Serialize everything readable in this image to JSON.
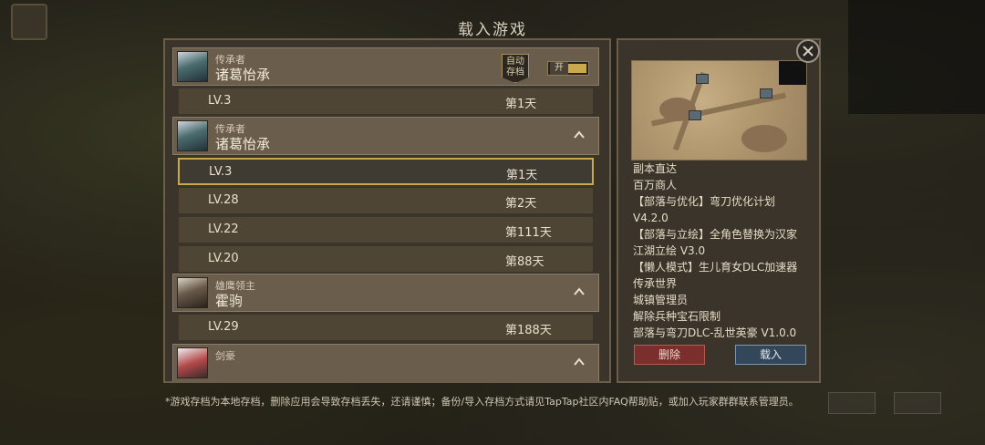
{
  "title": "载入游戏",
  "saves": [
    {
      "role": "传承者",
      "name": "诸葛怡承",
      "autosave_label": "自动存档",
      "toggle_label": "开",
      "entries": [
        {
          "level": "LV.3",
          "day": "第1天"
        }
      ]
    },
    {
      "role": "传承者",
      "name": "诸葛怡承",
      "entries": [
        {
          "level": "LV.3",
          "day": "第1天",
          "selected": true
        },
        {
          "level": "LV.28",
          "day": "第2天"
        },
        {
          "level": "LV.22",
          "day": "第111天"
        },
        {
          "level": "LV.20",
          "day": "第88天"
        }
      ]
    },
    {
      "role": "雄鹰领主",
      "name": "霍驹",
      "entries": [
        {
          "level": "LV.29",
          "day": "第188天"
        }
      ]
    },
    {
      "role": "剑豪",
      "name": "",
      "entries": []
    }
  ],
  "details": {
    "mods": [
      "副本直达",
      "百万商人",
      "【部落与优化】弯刀优化计划",
      "V4.2.0",
      "【部落与立绘】全角色替换为汉家",
      "江湖立绘 V3.0",
      "【懒人模式】生儿育女DLC加速器",
      "传承世界",
      "城镇管理员",
      "解除兵种宝石限制",
      "部落与弯刀DLC-乱世英豪 V1.0.0"
    ],
    "delete_label": "删除",
    "load_label": "载入"
  },
  "footer": "*游戏存档为本地存档，删除应用会导致存档丢失，还请谨慎；备份/导入存档方式请见TapTap社区内FAQ帮助贴，或加入玩家群群联系管理员。",
  "colors": {
    "selected_border": "#c9a94b",
    "delete_button": "#7a2f2c",
    "load_button": "#33475a"
  }
}
